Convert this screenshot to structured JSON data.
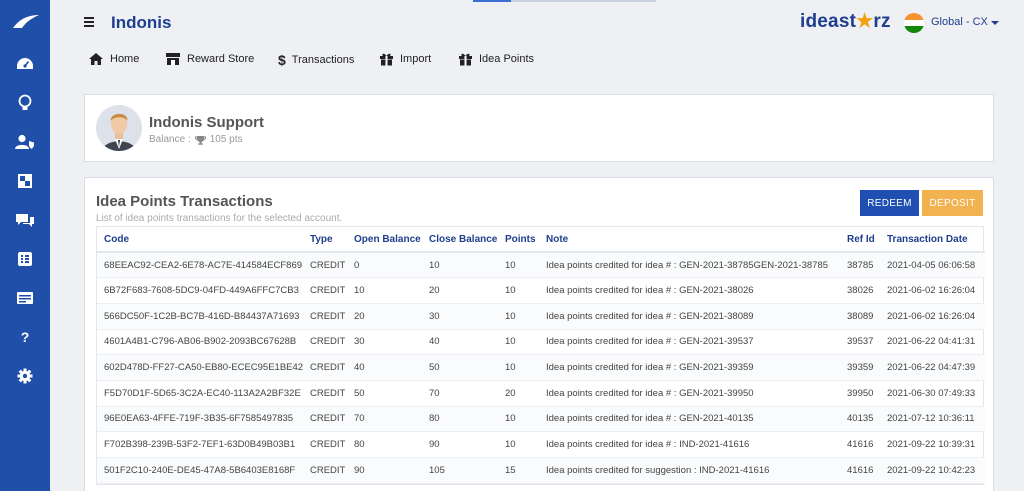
{
  "app": {
    "title": "Indonis",
    "brand_main": "ideast",
    "brand_star": "★",
    "brand_end": "rz",
    "region": "Global - CX"
  },
  "sidebar": {
    "items": [
      {
        "icon": "dashboard-icon"
      },
      {
        "icon": "lightbulb-icon"
      },
      {
        "icon": "user-shield-icon"
      },
      {
        "icon": "widget-icon"
      },
      {
        "icon": "chat-icon"
      },
      {
        "icon": "list-icon"
      },
      {
        "icon": "card-icon"
      },
      {
        "icon": "help-icon"
      },
      {
        "icon": "gear-icon"
      }
    ],
    "help_label": "?"
  },
  "nav": {
    "home": "Home",
    "reward_store": "Reward Store",
    "transactions": "Transactions",
    "import": "Import",
    "idea_points": "Idea Points"
  },
  "profile": {
    "name": "Indonis Support",
    "balance_label": "Balance :",
    "balance_value": "105 pts"
  },
  "transactions": {
    "title": "Idea Points Transactions",
    "subtitle": "List of idea points transactions for the selected account.",
    "redeem_label": "REDEEM",
    "deposit_label": "DEPOSIT",
    "columns": [
      "Code",
      "Type",
      "Open Balance",
      "Close Balance",
      "Points",
      "Note",
      "Ref Id",
      "Transaction Date"
    ],
    "rows": [
      [
        "68EEAC92-CEA2-6E78-AC7E-414584ECF869",
        "CREDIT",
        "0",
        "10",
        "10",
        "Idea points credited for idea # : GEN-2021-38785GEN-2021-38785",
        "38785",
        "2021-04-05 06:06:58"
      ],
      [
        "6B72F683-7608-5DC9-04FD-449A6FFC7CB3",
        "CREDIT",
        "10",
        "20",
        "10",
        "Idea points credited for idea # : GEN-2021-38026",
        "38026",
        "2021-06-02 16:26:04"
      ],
      [
        "566DC50F-1C2B-BC7B-416D-B84437A71693",
        "CREDIT",
        "20",
        "30",
        "10",
        "Idea points credited for idea # : GEN-2021-38089",
        "38089",
        "2021-06-02 16:26:04"
      ],
      [
        "4601A4B1-C796-AB06-B902-2093BC67628B",
        "CREDIT",
        "30",
        "40",
        "10",
        "Idea points credited for idea # : GEN-2021-39537",
        "39537",
        "2021-06-22 04:41:31"
      ],
      [
        "602D478D-FF27-CA50-EB80-ECEC95E1BE42",
        "CREDIT",
        "40",
        "50",
        "10",
        "Idea points credited for idea # : GEN-2021-39359",
        "39359",
        "2021-06-22 04:47:39"
      ],
      [
        "F5D70D1F-5D65-3C2A-EC40-113A2A2BF32E",
        "CREDIT",
        "50",
        "70",
        "20",
        "Idea points credited for idea # : GEN-2021-39950",
        "39950",
        "2021-06-30 07:49:33"
      ],
      [
        "96E0EA63-4FFE-719F-3B35-6F7585497835",
        "CREDIT",
        "70",
        "80",
        "10",
        "Idea points credited for idea # : GEN-2021-40135",
        "40135",
        "2021-07-12 10:36:11"
      ],
      [
        "F702B398-239B-53F2-7EF1-63D0B49B03B1",
        "CREDIT",
        "80",
        "90",
        "10",
        "Idea points credited for idea # : IND-2021-41616",
        "41616",
        "2021-09-22 10:39:31"
      ],
      [
        "501F2C10-240E-DE45-47A8-5B6403E8168F",
        "CREDIT",
        "90",
        "105",
        "15",
        "Idea points credited for suggestion : IND-2021-41616",
        "41616",
        "2021-09-22 10:42:23"
      ]
    ]
  },
  "colors": {
    "sidebar": "#1f4fa8",
    "brand": "#1f3e8c",
    "redeem": "#1f4fb0",
    "deposit": "#f2b24f",
    "star": "#f2a10f"
  }
}
